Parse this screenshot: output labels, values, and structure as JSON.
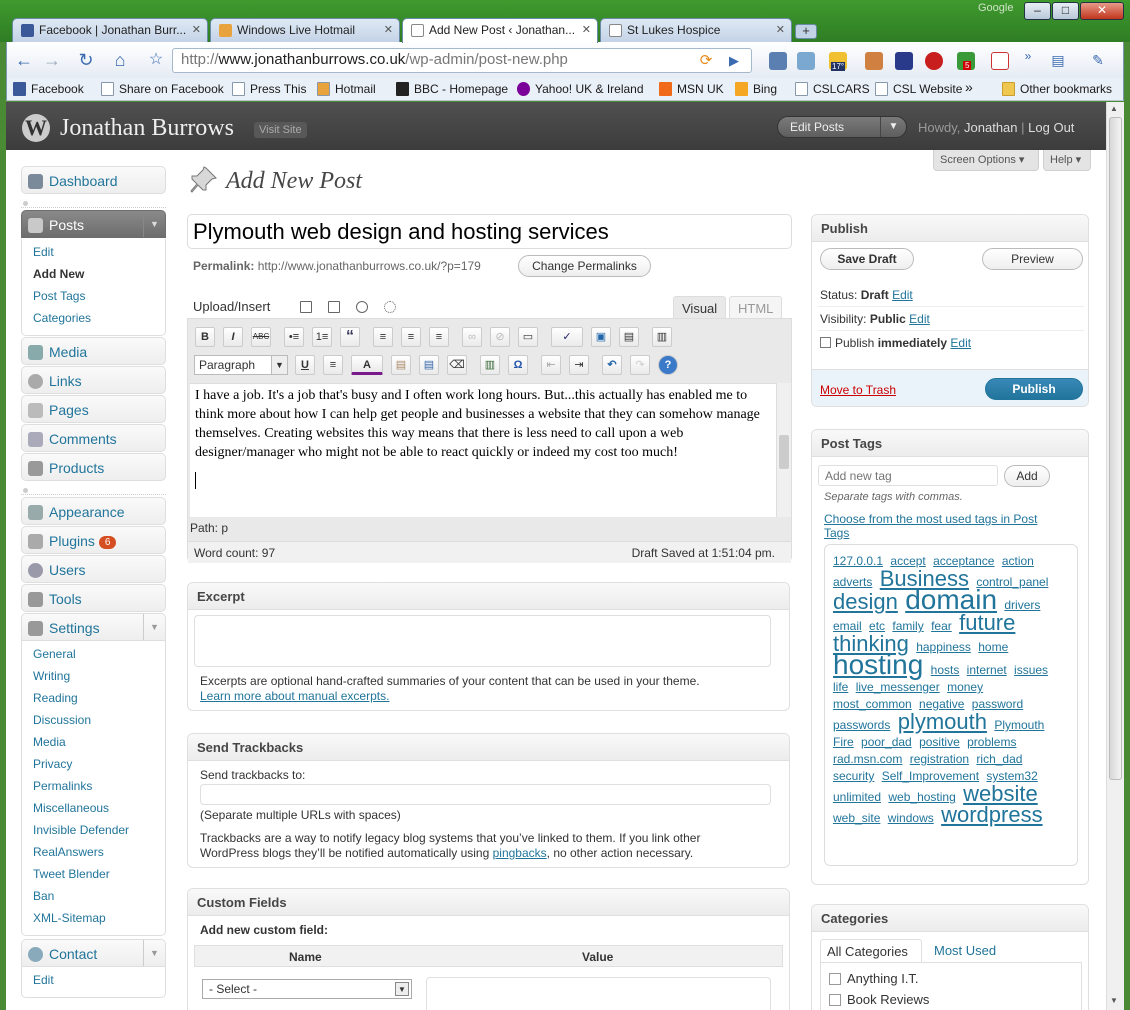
{
  "browser": {
    "tabs": [
      {
        "label": "Facebook | Jonathan Burr...",
        "color": "#3b5998"
      },
      {
        "label": "Windows Live Hotmail",
        "color": "#e8a33c"
      },
      {
        "label": "Add New Post ‹ Jonathan...",
        "color": "#ffffff"
      },
      {
        "label": "St Lukes Hospice",
        "color": "#d0d0d0"
      }
    ],
    "new_tab_label": "+",
    "google_label": "Google",
    "window_buttons": {
      "minimize": "–",
      "maximize": "□",
      "close": "✕"
    },
    "url_prefix": "http://",
    "url_domain": "www.jonathanburrows.co.uk",
    "url_path": "/wp-admin/post-new.php",
    "extension_badges": {
      "weather": "17°",
      "gmail": "5"
    },
    "bookmarks": [
      "Facebook",
      "Share on Facebook",
      "Press This",
      "Hotmail",
      "BBC - Homepage",
      "Yahoo! UK & Ireland",
      "MSN UK",
      "Bing",
      "CSLCARS",
      "CSL Website"
    ],
    "bookmarks_more": "»",
    "other_bookmarks": "Other bookmarks"
  },
  "wp_header": {
    "site_name": "Jonathan Burrows",
    "visit_site": "Visit Site",
    "favorite_action": "Edit Posts",
    "howdy": "Howdy,",
    "user": "Jonathan",
    "separator": "|",
    "logout": "Log Out",
    "screen_options": "Screen Options ▾",
    "help": "Help ▾"
  },
  "menu": {
    "dashboard": "Dashboard",
    "posts": "Posts",
    "posts_sub": [
      "Edit",
      "Add New",
      "Post Tags",
      "Categories"
    ],
    "media": "Media",
    "links": "Links",
    "pages": "Pages",
    "comments": "Comments",
    "products": "Products",
    "appearance": "Appearance",
    "plugins": "Plugins",
    "plugins_badge": "6",
    "users": "Users",
    "tools": "Tools",
    "settings": "Settings",
    "settings_sub": [
      "General",
      "Writing",
      "Reading",
      "Discussion",
      "Media",
      "Privacy",
      "Permalinks",
      "Miscellaneous",
      "Invisible Defender",
      "RealAnswers",
      "Tweet Blender",
      "Ban",
      "XML-Sitemap"
    ],
    "contact": "Contact",
    "contact_sub": [
      "Edit"
    ]
  },
  "page": {
    "title": "Add New Post",
    "post_title": "Plymouth web design and hosting services",
    "permalink_label": "Permalink:",
    "permalink_url": "http://www.jonathanburrows.co.uk/?p=179",
    "change_permalinks": "Change Permalinks"
  },
  "editor": {
    "upload_insert": "Upload/Insert",
    "tab_visual": "Visual",
    "tab_html": "HTML",
    "format_select": "Paragraph",
    "body_text": "I have a job.  It's a job that's busy and I often work long hours. But...this actually has enabled me to think more about how I can help get people and businesses a website that they can somehow manage themselves.  Creating websites this way means that there is less need to call upon a web designer/manager who might not be able to react quickly or indeed my cost too much!",
    "path": "Path: p",
    "word_count": "Word count: 97",
    "draft_saved": "Draft Saved at 1:51:04 pm.",
    "toolbar_row1": [
      "B",
      "I",
      "ABC",
      "•≡",
      "1≡",
      "“",
      "≡",
      "≡",
      "≡",
      "∞",
      "⊘",
      "▭",
      "✓",
      "▣",
      "▤",
      "▥"
    ],
    "toolbar_row2": [
      "U",
      "≡",
      "A",
      "▤",
      "▤",
      "⌫",
      "▥",
      "Ω",
      "⇤",
      "⇥",
      "↶",
      "↷",
      "?"
    ]
  },
  "excerpt": {
    "title": "Excerpt",
    "help": "Excerpts are optional hand-crafted summaries of your content that can be used in your theme.",
    "link": "Learn more about manual excerpts."
  },
  "trackbacks": {
    "title": "Send Trackbacks",
    "label": "Send trackbacks to:",
    "note": "(Separate multiple URLs with spaces)",
    "help_1": "Trackbacks are a way to notify legacy blog systems that you’ve linked to them. If you link other",
    "help_2": "WordPress blogs they’ll be notified automatically using",
    "help_link": "pingbacks",
    "help_3": ", no other action necessary."
  },
  "custom_fields": {
    "title": "Custom Fields",
    "add_new": "Add new custom field:",
    "col_name": "Name",
    "col_value": "Value",
    "select": "- Select -"
  },
  "publish": {
    "title": "Publish",
    "save_draft": "Save Draft",
    "preview": "Preview",
    "status_label": "Status:",
    "status_value": "Draft",
    "visibility_label": "Visibility:",
    "visibility_value": "Public",
    "publish_label": "Publish",
    "publish_value": "immediately",
    "edit": "Edit",
    "move_to_trash": "Move to Trash",
    "publish_button": "Publish"
  },
  "post_tags": {
    "title": "Post Tags",
    "placeholder": "Add new tag",
    "add": "Add",
    "separate": "Separate tags with commas.",
    "choose_1": "Choose from the most used tags in Post",
    "choose_2": "Tags",
    "cloud": [
      {
        "t": "127.0.0.1",
        "s": 12
      },
      {
        "t": "accept",
        "s": 12
      },
      {
        "t": "acceptance",
        "s": 12
      },
      {
        "t": "action",
        "s": 12
      },
      {
        "t": "adverts",
        "s": 12
      },
      {
        "t": "Business",
        "s": 22
      },
      {
        "t": "control_panel",
        "s": 12
      },
      {
        "t": "design",
        "s": 22
      },
      {
        "t": "domain",
        "s": 28
      },
      {
        "t": "drivers",
        "s": 12
      },
      {
        "t": "email",
        "s": 12
      },
      {
        "t": "etc",
        "s": 12
      },
      {
        "t": "family",
        "s": 12
      },
      {
        "t": "fear",
        "s": 12
      },
      {
        "t": "future",
        "s": 22
      },
      {
        "t": "thinking",
        "s": 22
      },
      {
        "t": "happiness",
        "s": 12
      },
      {
        "t": "home",
        "s": 12
      },
      {
        "t": "hosting",
        "s": 28
      },
      {
        "t": "hosts",
        "s": 12
      },
      {
        "t": "internet",
        "s": 12
      },
      {
        "t": "issues",
        "s": 12
      },
      {
        "t": "life",
        "s": 12
      },
      {
        "t": "live_messenger",
        "s": 12
      },
      {
        "t": "money",
        "s": 12
      },
      {
        "t": "most_common",
        "s": 12
      },
      {
        "t": "negative",
        "s": 12
      },
      {
        "t": "password",
        "s": 12
      },
      {
        "t": "passwords",
        "s": 12
      },
      {
        "t": "plymouth",
        "s": 22
      },
      {
        "t": "Plymouth",
        "s": 12
      },
      {
        "t": "Fire",
        "s": 12
      },
      {
        "t": "poor_dad",
        "s": 12
      },
      {
        "t": "positive",
        "s": 12
      },
      {
        "t": "problems",
        "s": 12
      },
      {
        "t": "rad.msn.com",
        "s": 12
      },
      {
        "t": "registration",
        "s": 12
      },
      {
        "t": "rich_dad",
        "s": 12
      },
      {
        "t": "security",
        "s": 12
      },
      {
        "t": "Self_Improvement",
        "s": 12
      },
      {
        "t": "system32",
        "s": 12
      },
      {
        "t": "unlimited",
        "s": 12
      },
      {
        "t": "web_hosting",
        "s": 12
      },
      {
        "t": "website",
        "s": 22
      },
      {
        "t": "web_site",
        "s": 12
      },
      {
        "t": "windows",
        "s": 12
      },
      {
        "t": "wordpress",
        "s": 22
      }
    ]
  },
  "categories": {
    "title": "Categories",
    "tab_all": "All Categories",
    "tab_used": "Most Used",
    "items": [
      "Anything I.T.",
      "Book Reviews"
    ]
  }
}
